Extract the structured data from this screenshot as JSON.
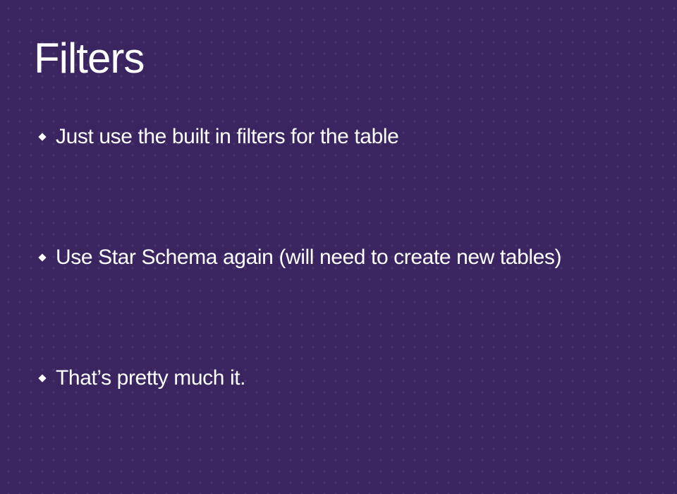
{
  "slide": {
    "title": "Filters",
    "bullets": [
      {
        "text": "Just use the built in filters for the table",
        "icon": "diamond-bullet-icon"
      },
      {
        "text": "Use Star Schema again (will need to create new tables)",
        "icon": "diamond-bullet-icon"
      },
      {
        "text": "That’s pretty much it.",
        "icon": "diamond-bullet-icon"
      }
    ]
  },
  "colors": {
    "background": "#3a2560",
    "text": "#ffffff"
  }
}
